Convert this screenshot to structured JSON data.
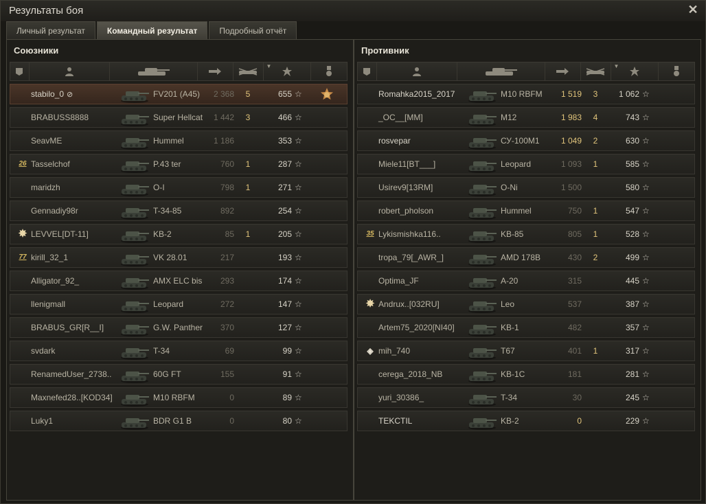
{
  "window": {
    "title": "Результаты боя",
    "close_glyph": "✕"
  },
  "tabs": [
    {
      "label": "Личный результат",
      "active": false
    },
    {
      "label": "Командный результат",
      "active": true
    },
    {
      "label": "Подробный отчёт",
      "active": false
    }
  ],
  "columns": [
    "squad-icon",
    "player-icon",
    "vehicle-icon",
    "damage-icon",
    "kills-icon",
    "xp-star-icon",
    "medal-icon"
  ],
  "xp_star_glyph": "☆",
  "colors": {
    "damage_highlight": "#e0c47b",
    "self_row": "#4a3528"
  },
  "allies": {
    "title": "Союзники",
    "players": [
      {
        "name": "stabilo_0",
        "vehicle": "FV201 (A45)",
        "damage": "2 368",
        "kills": "5",
        "xp": "655",
        "self": true,
        "hidden": true,
        "medal": "medal-icon"
      },
      {
        "name": "BRABUSS8888",
        "vehicle": "Super Hellcat",
        "damage": "1 442",
        "kills": "3",
        "xp": "466"
      },
      {
        "name": "SeavME",
        "vehicle": "Hummel",
        "damage": "1 186",
        "kills": "",
        "xp": "353"
      },
      {
        "name": "Tasselchof",
        "vehicle": "P.43 ter",
        "damage": "760",
        "kills": "1",
        "xp": "287",
        "badge": "26",
        "badge_type": "ring"
      },
      {
        "name": "maridzh",
        "vehicle": "O-I",
        "damage": "798",
        "kills": "1",
        "xp": "271"
      },
      {
        "name": "Gennadiy98r",
        "vehicle": "T-34-85",
        "damage": "892",
        "kills": "",
        "xp": "254"
      },
      {
        "name": "LEVVEL[DT-11]",
        "vehicle": "KB-2",
        "damage": "85",
        "kills": "1",
        "xp": "205",
        "badge": "✸",
        "badge_type": "star"
      },
      {
        "name": "kirill_32_1",
        "vehicle": "VK 28.01",
        "damage": "217",
        "kills": "",
        "xp": "193",
        "badge": "77",
        "badge_type": "ring"
      },
      {
        "name": "Alligator_92_",
        "vehicle": "AMX ELC bis",
        "damage": "293",
        "kills": "",
        "xp": "174"
      },
      {
        "name": "llenigmall",
        "vehicle": "Leopard",
        "damage": "272",
        "kills": "",
        "xp": "147"
      },
      {
        "name": "BRABUS_GR[R__I]",
        "vehicle": "G.W. Panther",
        "damage": "370",
        "kills": "",
        "xp": "127"
      },
      {
        "name": "svdark",
        "vehicle": "T-34",
        "damage": "69",
        "kills": "",
        "xp": "99"
      },
      {
        "name": "RenamedUser_2738..",
        "vehicle": "60G FT",
        "damage": "155",
        "kills": "",
        "xp": "91"
      },
      {
        "name": "Maxnefed28..[KOD34]",
        "vehicle": "M10 RBFM",
        "damage": "0",
        "kills": "",
        "xp": "89"
      },
      {
        "name": "Luky1",
        "vehicle": "BDR G1 B",
        "damage": "0",
        "kills": "",
        "xp": "80"
      }
    ]
  },
  "enemies": {
    "title": "Противник",
    "players": [
      {
        "name": "Romahka2015_2017",
        "vehicle": "M10 RBFM",
        "damage": "1 519",
        "kills": "3",
        "xp": "1 062",
        "hi": true,
        "bright": true
      },
      {
        "name": "_OC__[MM]",
        "vehicle": "M12",
        "damage": "1 983",
        "kills": "4",
        "xp": "743",
        "hi": true
      },
      {
        "name": "rosvepar",
        "vehicle": "СУ-100М1",
        "damage": "1 049",
        "kills": "2",
        "xp": "630",
        "hi": true,
        "bright": true
      },
      {
        "name": "Miele11[BT___]",
        "vehicle": "Leopard",
        "damage": "1 093",
        "kills": "1",
        "xp": "585"
      },
      {
        "name": "Usirev9[13RM]",
        "vehicle": "O-Ni",
        "damage": "1 500",
        "kills": "",
        "xp": "580"
      },
      {
        "name": "robert_pholson",
        "vehicle": "Hummel",
        "damage": "750",
        "kills": "1",
        "xp": "547"
      },
      {
        "name": "Lykismishka116..",
        "vehicle": "KB-85",
        "damage": "805",
        "kills": "1",
        "xp": "528",
        "badge": "35",
        "badge_type": "ring"
      },
      {
        "name": "tropa_79[_AWR_]",
        "vehicle": "AMD 178B",
        "damage": "430",
        "kills": "2",
        "xp": "499"
      },
      {
        "name": "Optima_JF",
        "vehicle": "A-20",
        "damage": "315",
        "kills": "",
        "xp": "445"
      },
      {
        "name": "Andrux..[032RU]",
        "vehicle": "Leo",
        "damage": "537",
        "kills": "",
        "xp": "387",
        "badge": "✸",
        "badge_type": "star"
      },
      {
        "name": "Artem75_2020[NI40]",
        "vehicle": "KB-1",
        "damage": "482",
        "kills": "",
        "xp": "357"
      },
      {
        "name": "mih_740",
        "vehicle": "T67",
        "damage": "401",
        "kills": "1",
        "xp": "317",
        "badge": "◈",
        "badge_type": "diamond"
      },
      {
        "name": "cerega_2018_NB",
        "vehicle": "KB-1C",
        "damage": "181",
        "kills": "",
        "xp": "281"
      },
      {
        "name": "yuri_30386_",
        "vehicle": "T-34",
        "damage": "30",
        "kills": "",
        "xp": "245"
      },
      {
        "name": "TEKCTIL",
        "vehicle": "KB-2",
        "damage": "0",
        "kills": "",
        "xp": "229",
        "hi": true,
        "bright": true
      }
    ]
  }
}
